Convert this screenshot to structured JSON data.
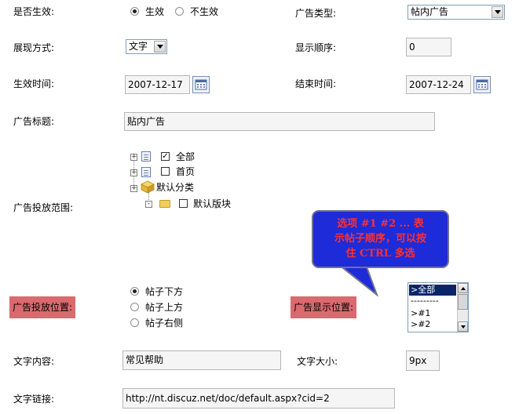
{
  "fields": {
    "active": {
      "label": "是否生效:",
      "options": [
        "生效",
        "不生效"
      ],
      "selected": 0
    },
    "ad_type": {
      "label": "广告类型:",
      "value": "帖内广告"
    },
    "display_mode": {
      "label": "展现方式:",
      "value": "文字"
    },
    "display_order": {
      "label": "显示顺序:",
      "value": "0"
    },
    "start_time": {
      "label": "生效时间:",
      "value": "2007-12-17"
    },
    "end_time": {
      "label": "结束时间:",
      "value": "2007-12-24"
    },
    "ad_title": {
      "label": "广告标题:",
      "value": "贴内广告"
    },
    "ad_scope": {
      "label": "广告投放范围:",
      "tree": [
        {
          "label": "全部",
          "checked": true
        },
        {
          "label": "首页",
          "checked": false
        },
        {
          "label": "默认分类"
        },
        {
          "label": "默认版块",
          "checked": false
        }
      ]
    },
    "ad_position": {
      "label": "广告投放位置:",
      "options": [
        "帖子下方",
        "帖子上方",
        "帖子右侧"
      ],
      "selected": 0
    },
    "ad_display_position": {
      "label": "广告显示位置:",
      "options": [
        ">全部",
        "---------",
        ">#1",
        ">#2"
      ],
      "selected": 0
    },
    "text_content": {
      "label": "文字内容:",
      "value": "常见帮助"
    },
    "text_size": {
      "label": "文字大小:",
      "value": "9px"
    },
    "text_link": {
      "label": "文字链接:",
      "value": "http://nt.discuz.net/doc/default.aspx?cid=2"
    }
  },
  "callout": {
    "line1": "选项 #1 #2 ... 表",
    "line2": "示帖子顺序，可以按",
    "line3": "住 CTRL 多选"
  },
  "colors": {
    "highlight_label": "#d96a6f",
    "callout_bg": "#1d2bd8",
    "callout_text": "#ff3030",
    "selected_option_bg": "#0a246a"
  },
  "icons": {
    "calendar": "calendar-icon",
    "expand": "plus-box-icon",
    "page": "page-icon",
    "category": "cube-icon",
    "folder": "folder-icon"
  }
}
